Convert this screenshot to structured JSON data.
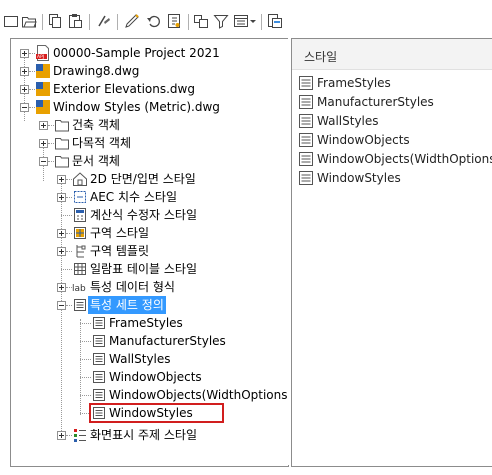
{
  "toolbar": {
    "buttons": [
      "new-icon",
      "open-icon",
      "copy-icon",
      "paste-icon",
      "purge-icon",
      "edit-icon",
      "undo-icon",
      "properties-icon",
      "view-icon",
      "filter-icon",
      "view-mode-icon",
      "dropdown-icon",
      "dock-icon"
    ]
  },
  "tree": {
    "items": [
      {
        "label": "00000-Sample Project 2021"
      },
      {
        "label": "Drawing8.dwg"
      },
      {
        "label": "Exterior Elevations.dwg"
      },
      {
        "label": "Window Styles (Metric).dwg"
      },
      {
        "label": "건축 객체"
      },
      {
        "label": "다목적 객체"
      },
      {
        "label": "문서 객체"
      },
      {
        "label": "2D 단면/입면 스타일"
      },
      {
        "label": "AEC 치수 스타일"
      },
      {
        "label": "계산식 수정자 스타일"
      },
      {
        "label": "구역 스타일"
      },
      {
        "label": "구역 템플릿"
      },
      {
        "label": "일람표 테이블 스타일"
      },
      {
        "label": "특성 데이터 형식"
      },
      {
        "label": "특성 세트 정의"
      },
      {
        "label": "FrameStyles"
      },
      {
        "label": "ManufacturerStyles"
      },
      {
        "label": "WallStyles"
      },
      {
        "label": "WindowObjects"
      },
      {
        "label": "WindowObjects(WidthOptions)"
      },
      {
        "label": "WindowStyles"
      },
      {
        "label": "화면표시 주제 스타일"
      }
    ]
  },
  "list": {
    "header": "스타일",
    "items": [
      {
        "label": "FrameStyles"
      },
      {
        "label": "ManufacturerStyles"
      },
      {
        "label": "WallStyles"
      },
      {
        "label": "WindowObjects"
      },
      {
        "label": "WindowObjects(WidthOptions)"
      },
      {
        "label": "WindowStyles"
      }
    ]
  },
  "colors": {
    "selection": "#3399ff",
    "highlight_border": "#d11e1e"
  }
}
